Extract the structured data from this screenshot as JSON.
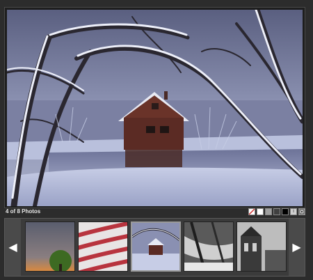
{
  "gallery": {
    "status_text": "4 of 8 Photos",
    "current_index": 4,
    "total": 8
  },
  "controls": [
    {
      "name": "no-background-icon"
    },
    {
      "name": "white-background-swatch"
    },
    {
      "name": "gray-background-swatch"
    },
    {
      "name": "dark-background-swatch"
    },
    {
      "name": "black-background-swatch"
    },
    {
      "name": "info-icon"
    },
    {
      "name": "fullscreen-icon"
    }
  ],
  "thumbnails": [
    {
      "name": "thumb-tree-sunset",
      "active": false
    },
    {
      "name": "thumb-flag",
      "active": false
    },
    {
      "name": "thumb-cabin",
      "active": true
    },
    {
      "name": "thumb-stream",
      "active": false
    },
    {
      "name": "thumb-church",
      "active": false
    }
  ],
  "colors": {
    "background": "#2c2c2c",
    "strip": "#3b3b3b",
    "text": "#e6e6e6"
  }
}
